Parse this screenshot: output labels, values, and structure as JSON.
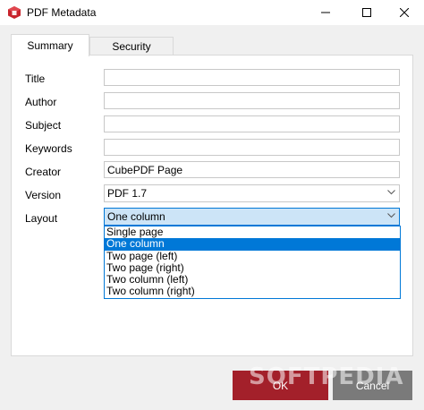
{
  "window": {
    "title": "PDF Metadata",
    "accent": "#0078d7",
    "brand_color": "#c8232c"
  },
  "tabs": [
    {
      "label": "Summary",
      "active": true
    },
    {
      "label": "Security",
      "active": false
    }
  ],
  "fields": {
    "title": {
      "label": "Title",
      "value": ""
    },
    "author": {
      "label": "Author",
      "value": ""
    },
    "subject": {
      "label": "Subject",
      "value": ""
    },
    "keywords": {
      "label": "Keywords",
      "value": ""
    },
    "creator": {
      "label": "Creator",
      "value": "CubePDF Page"
    },
    "version": {
      "label": "Version",
      "value": "PDF 1.7"
    },
    "layout": {
      "label": "Layout",
      "value": "One column"
    }
  },
  "layout_options": [
    {
      "label": "Single page",
      "selected": false
    },
    {
      "label": "One column",
      "selected": true
    },
    {
      "label": "Two page (left)",
      "selected": false
    },
    {
      "label": "Two page (right)",
      "selected": false
    },
    {
      "label": "Two column (left)",
      "selected": false
    },
    {
      "label": "Two column (right)",
      "selected": false
    }
  ],
  "buttons": {
    "ok": "OK",
    "cancel": "Cancel"
  },
  "watermark": "SOFTPEDIA"
}
